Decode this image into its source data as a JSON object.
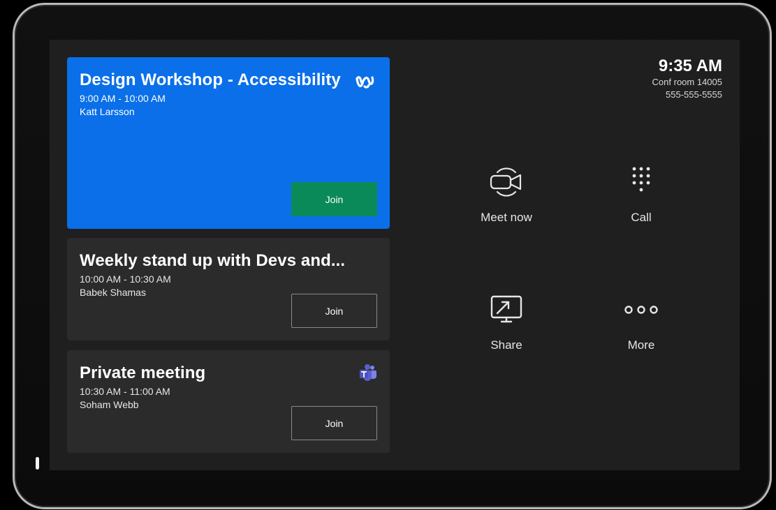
{
  "meetings": [
    {
      "title": "Design Workshop - Accessibility",
      "time": "9:00 AM - 10:00 AM",
      "host": "Katt Larsson",
      "join_label": "Join",
      "service_icon": "webex-icon"
    },
    {
      "title": "Weekly stand up with Devs and...",
      "time": "10:00 AM - 10:30 AM",
      "host": "Babek Shamas",
      "join_label": "Join"
    },
    {
      "title": "Private meeting",
      "time": "10:30 AM - 11:00 AM",
      "host": "Soham Webb",
      "join_label": "Join",
      "service_icon": "teams-icon"
    }
  ],
  "status": {
    "time": "9:35 AM",
    "room": "Conf room 14005",
    "phone": "555-555-5555"
  },
  "actions": [
    {
      "label": "Meet now",
      "icon": "video-camera-icon"
    },
    {
      "label": "Call",
      "icon": "dialpad-icon"
    },
    {
      "label": "Share",
      "icon": "screen-share-icon"
    },
    {
      "label": "More",
      "icon": "more-icon"
    }
  ],
  "colors": {
    "primary_card": "#0a6fe9",
    "join_primary": "#0a8a58",
    "card_bg": "#2b2b2b",
    "screen_bg": "#1f1f1f"
  }
}
